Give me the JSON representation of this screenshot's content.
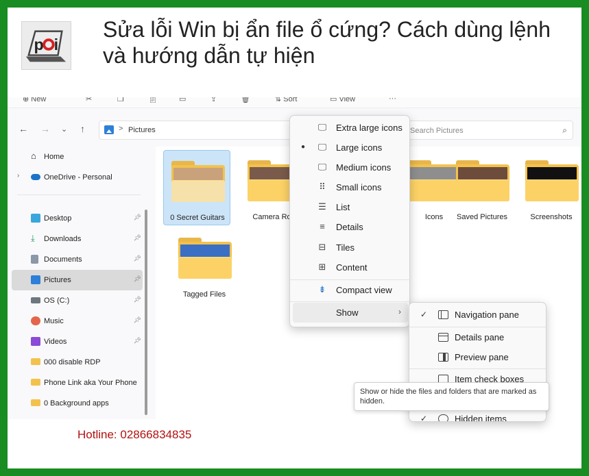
{
  "header": {
    "title": "Sửa lỗi Win bị ẩn file ổ cứng? Cách dùng lệnh và hướng dẫn tự hiện",
    "logo_text": "pci"
  },
  "footer": {
    "hotline": "Hotline: 02866834835"
  },
  "colors": {
    "frame": "#198c22",
    "hotline": "#b31010",
    "folder": "#f3c24d",
    "selection": "#cce4f7"
  },
  "explorer": {
    "commandbar": {
      "new_label": "New",
      "sort_label": "Sort",
      "view_label": "View"
    },
    "address": {
      "path": "Pictures",
      "separator": ">"
    },
    "search": {
      "placeholder": "Search Pictures"
    },
    "sidebar": {
      "items": [
        {
          "label": "Home",
          "icon": "home-icon"
        },
        {
          "label": "OneDrive - Personal",
          "icon": "cloud-icon"
        },
        {
          "label": "Desktop",
          "icon": "desktop-icon"
        },
        {
          "label": "Downloads",
          "icon": "download-icon"
        },
        {
          "label": "Documents",
          "icon": "document-icon"
        },
        {
          "label": "Pictures",
          "icon": "picture-icon"
        },
        {
          "label": "OS (C:)",
          "icon": "drive-icon"
        },
        {
          "label": "Music",
          "icon": "music-icon"
        },
        {
          "label": "Videos",
          "icon": "video-icon"
        },
        {
          "label": "000 disable RDP",
          "icon": "folder-icon"
        },
        {
          "label": "Phone Link aka Your Phone",
          "icon": "folder-icon"
        },
        {
          "label": "0 Background apps",
          "icon": "folder-icon"
        }
      ]
    },
    "files": [
      {
        "name": "0 Secret Guitars"
      },
      {
        "name": "Camera Roll"
      },
      {
        "name": "Icons"
      },
      {
        "name": "Saved Pictures"
      },
      {
        "name": "Screenshots"
      },
      {
        "name": "Tagged Files"
      }
    ],
    "context_menu": {
      "items": [
        {
          "label": "Extra large icons",
          "icon": "monitor-icon"
        },
        {
          "label": "Large icons",
          "icon": "monitor-icon"
        },
        {
          "label": "Medium icons",
          "icon": "monitor-icon"
        },
        {
          "label": "Small icons",
          "icon": "grid-icon"
        },
        {
          "label": "List",
          "icon": "list-icon"
        },
        {
          "label": "Details",
          "icon": "details-icon"
        },
        {
          "label": "Tiles",
          "icon": "tiles-icon"
        },
        {
          "label": "Content",
          "icon": "content-icon"
        },
        {
          "label": "Compact view",
          "icon": "compact-icon"
        },
        {
          "label": "Show",
          "icon": ""
        }
      ],
      "selected": "Large icons"
    },
    "show_submenu": {
      "items": [
        {
          "label": "Navigation pane",
          "checked": true
        },
        {
          "label": "Details pane",
          "checked": false
        },
        {
          "label": "Preview pane",
          "checked": false
        },
        {
          "label": "Item check boxes",
          "checked": false
        },
        {
          "label": "Hidden items",
          "checked": true
        }
      ]
    },
    "tooltip": "Show or hide the files and folders that are marked as hidden."
  }
}
